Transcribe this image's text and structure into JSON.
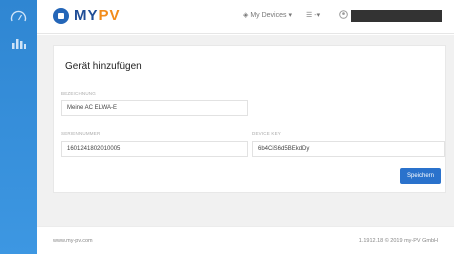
{
  "brand": {
    "logo_my": "MY",
    "logo_pv": "PV",
    "accent": "#f28c1b",
    "primary": "#2466b8"
  },
  "sidebar": {
    "items": [
      {
        "icon": "gauge-icon"
      },
      {
        "icon": "bar-chart-icon"
      }
    ]
  },
  "header": {
    "devices_label": "My Devices",
    "lang_label": "☰ -",
    "user_name": ""
  },
  "card": {
    "title": "Gerät hinzufügen",
    "fields": {
      "name": {
        "label": "BEZEICHNUNG",
        "value": "Meine AC ELWA-E"
      },
      "serial": {
        "label": "SERIENNUMMER",
        "value": "1601241802010005"
      },
      "key": {
        "label": "DEVICE KEY",
        "value": "6b4CiS6d5BEkdDy"
      }
    },
    "save_label": "Speichern"
  },
  "footer": {
    "left": "www.my-pv.com",
    "right": "1.1912.18 © 2019 my-PV GmbH"
  }
}
